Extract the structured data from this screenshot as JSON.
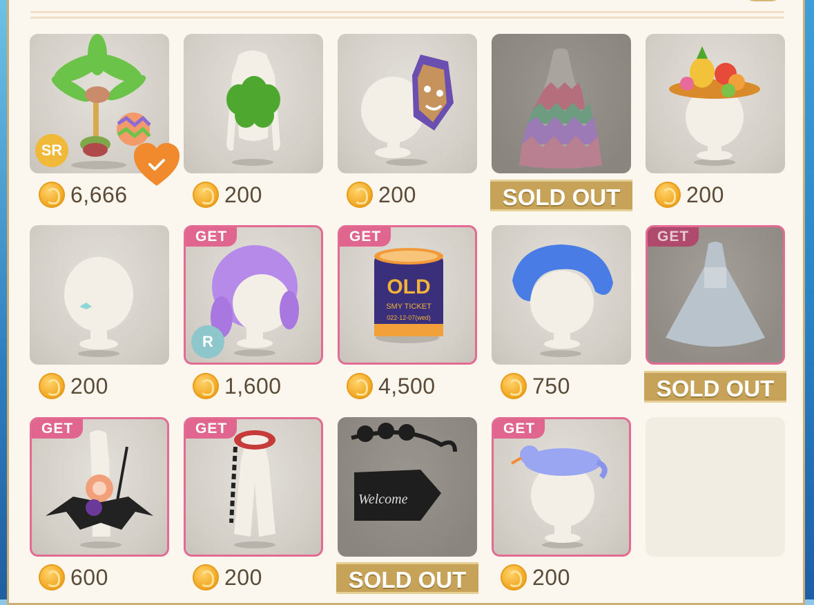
{
  "items": [
    {
      "price": "6,666",
      "rarity": "SR",
      "owned_heart": true
    },
    {
      "price": "200"
    },
    {
      "price": "200"
    },
    {
      "sold_out": "SOLD OUT"
    },
    {
      "price": "200"
    },
    {
      "price": "200"
    },
    {
      "price": "1,600",
      "badge": "GET",
      "rarity": "R"
    },
    {
      "price": "4,500",
      "badge": "GET",
      "ticket_text": "OLD",
      "ticket_sub": "SMY TICKET",
      "ticket_date": "022-12-07(wed)"
    },
    {
      "price": "750"
    },
    {
      "sold_out": "SOLD OUT",
      "badge": "GET"
    },
    {
      "price": "600",
      "badge": "GET"
    },
    {
      "price": "200",
      "badge": "GET"
    },
    {
      "sold_out": "SOLD OUT",
      "sign_text": "Welcome"
    },
    {
      "price": "200",
      "badge": "GET"
    },
    {}
  ],
  "colors": {
    "accent": "#e0658f",
    "coin": "#f2a926",
    "sold": "#c7a35a",
    "panel": "#fbf7ee"
  }
}
